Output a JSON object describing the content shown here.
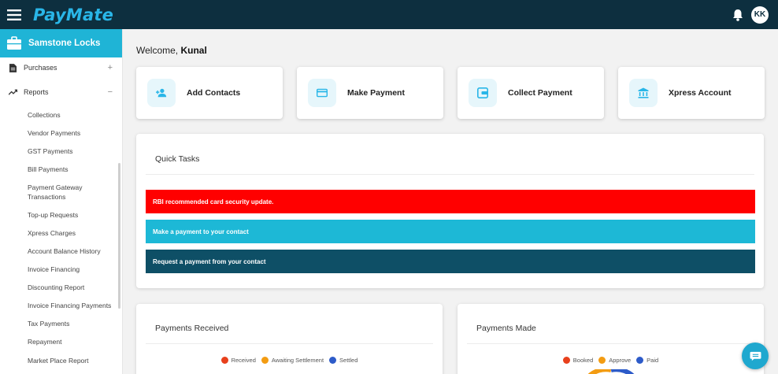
{
  "app": {
    "brand_pay": "Pay",
    "brand_mate": "Mate",
    "user_initials": "KK"
  },
  "sidebar": {
    "org_name": "Samstone Locks",
    "sections": [
      {
        "label": "Purchases",
        "toggle": "+"
      },
      {
        "label": "Reports",
        "toggle": "−"
      }
    ],
    "report_items": [
      "Collections",
      "Vendor Payments",
      "GST Payments",
      "Bill Payments",
      "Payment Gateway Transactions",
      "Top-up Requests",
      "Xpress Charges",
      "Account Balance History",
      "Invoice Financing",
      "Discounting Report",
      "Invoice Financing Payments",
      "Tax Payments",
      "Repayment",
      "Market Place Report"
    ]
  },
  "main": {
    "welcome_prefix": "Welcome, ",
    "welcome_name": "Kunal",
    "cards": [
      {
        "title": "Add Contacts",
        "icon": "add-contact-icon"
      },
      {
        "title": "Make Payment",
        "icon": "card-icon"
      },
      {
        "title": "Collect Payment",
        "icon": "wallet-icon"
      },
      {
        "title": "Xpress Account",
        "icon": "bank-icon"
      }
    ],
    "quick_tasks": {
      "title": "Quick Tasks",
      "items": [
        {
          "label": "RBI recommended card security update.",
          "color": "#ff0000"
        },
        {
          "label": "Make a payment to your contact",
          "color": "#1db8d6"
        },
        {
          "label": "Request a payment from your contact",
          "color": "#0e4f66"
        }
      ]
    },
    "payments_received": {
      "title": "Payments Received",
      "legend": [
        {
          "label": "Received",
          "color": "#e8401c"
        },
        {
          "label": "Awaiting Settlement",
          "color": "#f39c12"
        },
        {
          "label": "Settled",
          "color": "#2d5bc9"
        }
      ]
    },
    "payments_made": {
      "title": "Payments Made",
      "legend": [
        {
          "label": "Booked",
          "color": "#e8401c"
        },
        {
          "label": "Approve",
          "color": "#f39c12"
        },
        {
          "label": "Paid",
          "color": "#2d5bc9"
        }
      ]
    }
  }
}
